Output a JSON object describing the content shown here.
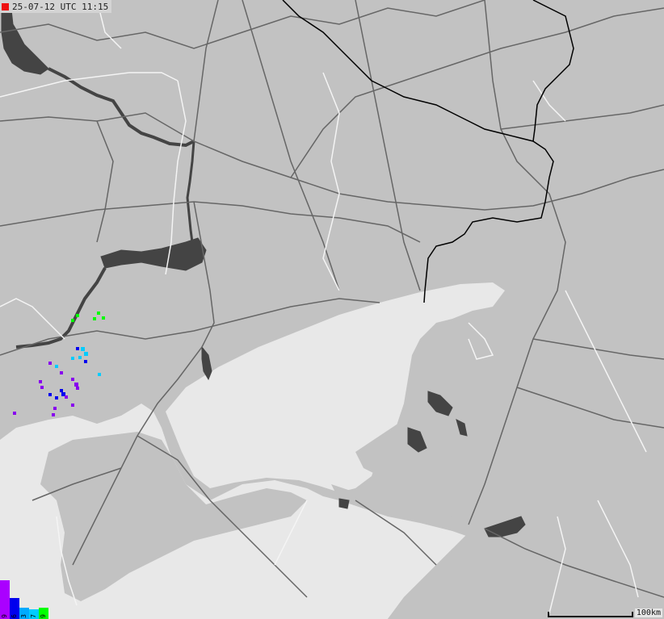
{
  "timestamp": {
    "text": "25-07-12 UTC 11:15",
    "marker_color": "#ee1111"
  },
  "legend": {
    "items": [
      {
        "label": "9",
        "color": "#00ff00"
      },
      {
        "label": "7",
        "color": "#00ccff"
      },
      {
        "label": "3",
        "color": "#0000ee"
      },
      {
        "label": "6",
        "color": "#7700ee"
      },
      {
        "label": "9",
        "color": "#aa00ff"
      }
    ]
  },
  "scale": {
    "label": "100km"
  },
  "colors": {
    "land": "#c2c2c2",
    "sea": "#e8e8e8",
    "water_bodies": "#444444",
    "roads": "#666666",
    "admin_borders": "#f4f4f4",
    "national_border": "#000000"
  }
}
